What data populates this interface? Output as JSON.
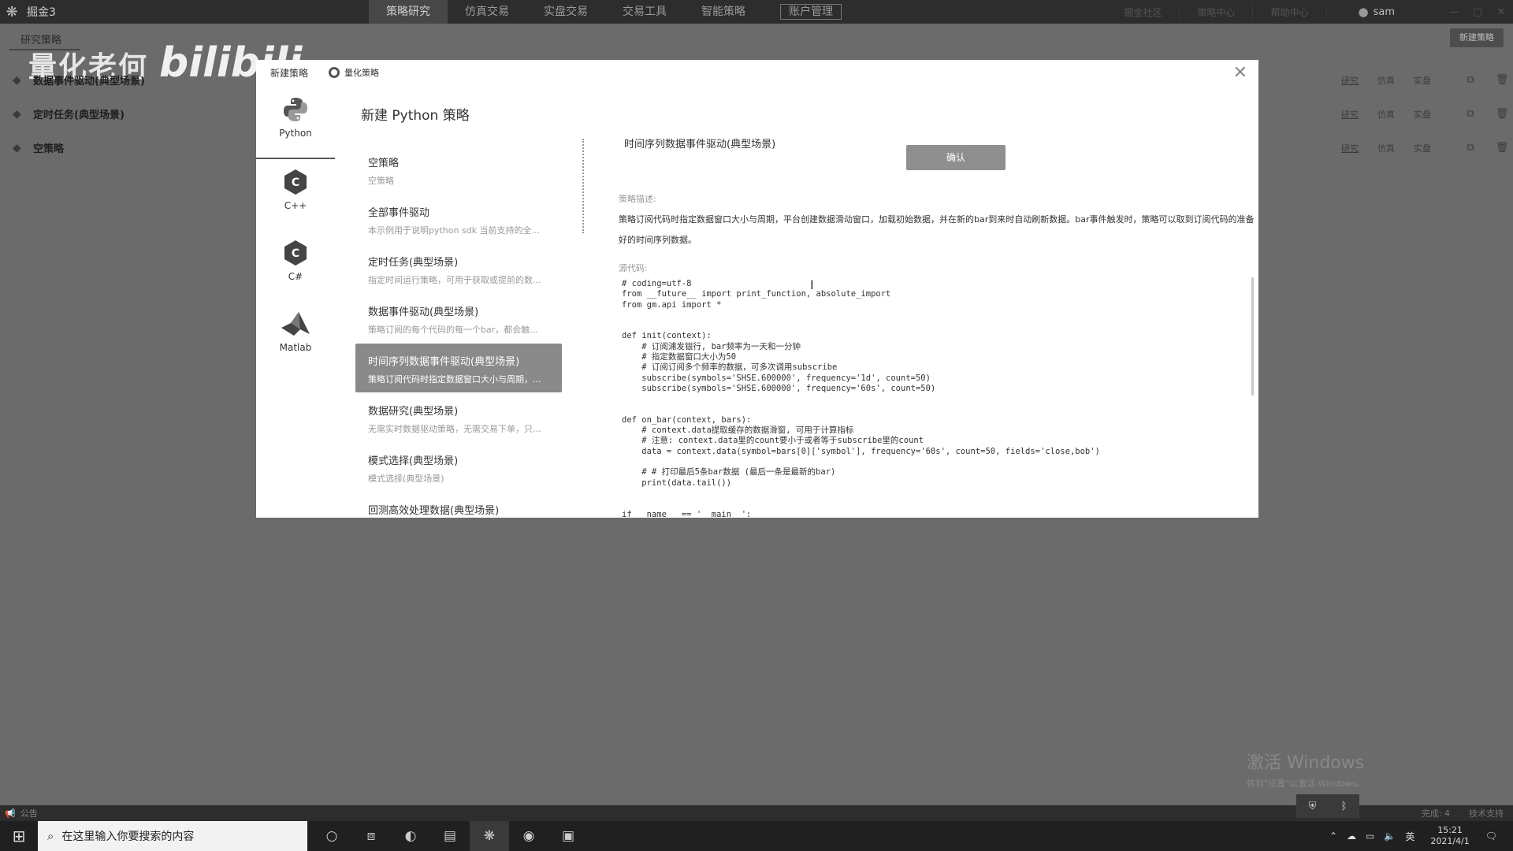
{
  "app": {
    "name": "掘金3"
  },
  "nav": [
    "策略研究",
    "仿真交易",
    "实盘交易",
    "交易工具",
    "智能策略",
    "账户管理"
  ],
  "top_links": [
    "掘金社区",
    "策略中心",
    "帮助中心"
  ],
  "user": {
    "name": "sam"
  },
  "subheader": {
    "title": "研究策略",
    "new_button": "新建策略"
  },
  "watermark": {
    "text": "量化老何",
    "brand": "bilibili"
  },
  "background_strategies": [
    {
      "name": "数据事件驱动(典型场景)"
    },
    {
      "name": "定时任务(典型场景)"
    },
    {
      "name": "空策略"
    }
  ],
  "row_tags": [
    "研究",
    "仿真",
    "实盘"
  ],
  "modal": {
    "title": "新建策略",
    "mode": "量化策略",
    "panel_title": "新建 Python 策略",
    "languages": [
      {
        "label": "Python",
        "icon": "python-icon"
      },
      {
        "label": "C++",
        "icon": "cpp-icon"
      },
      {
        "label": "C#",
        "icon": "csharp-icon"
      },
      {
        "label": "Matlab",
        "icon": "matlab-icon"
      }
    ],
    "templates": [
      {
        "name": "空策略",
        "desc": "空策略"
      },
      {
        "name": "全部事件驱动",
        "desc": "本示例用于说明python sdk 当前支持的全..."
      },
      {
        "name": "定时任务(典型场景)",
        "desc": "指定时间运行策略，可用于获取或提前的数..."
      },
      {
        "name": "数据事件驱动(典型场景)",
        "desc": "策略订阅的每个代码的每一个bar，都会触..."
      },
      {
        "name": "时间序列数据事件驱动(典型场景)",
        "desc": "策略订阅代码时指定数据窗口大小与周期，..."
      },
      {
        "name": "数据研究(典型场景)",
        "desc": "无需实时数据驱动策略，无需交易下单，只获..."
      },
      {
        "name": "模式选择(典型场景)",
        "desc": "模式选择(典型场景)"
      },
      {
        "name": "回测高效处理数据(典型场景)",
        "desc": ""
      }
    ],
    "selected_index": 4,
    "detail": {
      "title": "时间序列数据事件驱动(典型场景)",
      "confirm": "确认",
      "desc_label": "策略描述:",
      "desc": "策略订阅代码时指定数据窗口大小与周期，平台创建数据滑动窗口，加载初始数据，并在新的bar到来时自动刷新数据。bar事件触发时，策略可以取到订阅代码的准备好的时间序列数据。",
      "code_label": "源代码:",
      "code": "# coding=utf-8\nfrom __future__ import print_function, absolute_import\nfrom gm.api import *\n\n\ndef init(context):\n    # 订阅浦发银行, bar频率为一天和一分钟\n    # 指定数据窗口大小为50\n    # 订阅订阅多个频率的数据，可多次调用subscribe\n    subscribe(symbols='SHSE.600000', frequency='1d', count=50)\n    subscribe(symbols='SHSE.600000', frequency='60s', count=50)\n\n\ndef on_bar(context, bars):\n    # context.data提取缓存的数据滑窗, 可用于计算指标\n    # 注意: context.data里的count要小于或者等于subscribe里的count\n    data = context.data(symbol=bars[0]['symbol'], frequency='60s', count=50, fields='close,bob')\n\n    # # 打印最后5条bar数据 (最后一条是最新的bar)\n    print(data.tail())\n\n\nif __name__ == '__main__':"
    }
  },
  "activate": {
    "title": "激活 Windows",
    "subtitle": "转到\"设置\"以激活 Windows。"
  },
  "statusbar": {
    "notice": "公告",
    "done": "完成: 4",
    "support": "技术支持"
  },
  "taskbar": {
    "search_placeholder": "在这里输入你要搜索的内容",
    "time": "15:21",
    "date": "2021/4/1",
    "ime": "英"
  }
}
